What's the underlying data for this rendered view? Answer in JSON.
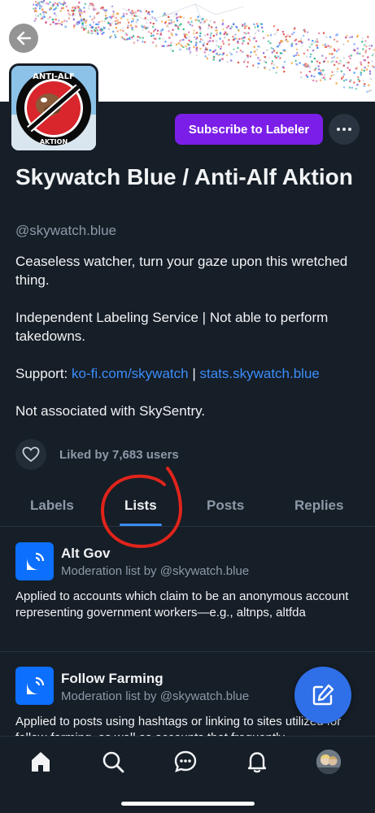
{
  "header": {
    "subscribe_label": "Subscribe to Labeler",
    "more_icon": "ellipsis-icon",
    "back_icon": "back-arrow-icon",
    "back_overlay_text": "Du"
  },
  "profile": {
    "display_name": "Skywatch Blue / Anti-Alf Aktion",
    "handle": "@skywatch.blue",
    "bio_line1": "Ceaseless watcher, turn your gaze upon this wretched thing.",
    "bio_line2": "Independent Labeling Service | Not able to perform takedowns.",
    "support_label": "Support: ",
    "support_link1": "ko-fi.com/skywatch",
    "support_sep": " | ",
    "support_link2": "stats.skywatch.blue",
    "bio_line4": "Not associated with SkySentry.",
    "avatar_text_top": "ANTI-ALF",
    "avatar_text_bottom": "AKTION",
    "likes_text": "Liked by 7,683 users"
  },
  "tabs": [
    {
      "label": "Labels",
      "active": false
    },
    {
      "label": "Lists",
      "active": true
    },
    {
      "label": "Posts",
      "active": false
    },
    {
      "label": "Replies",
      "active": false
    }
  ],
  "lists": [
    {
      "title": "Alt Gov",
      "subtitle": "Moderation list by @skywatch.blue",
      "description": "Applied to accounts which claim to be an anonymous account representing government workers—e.g., altnps, altfda"
    },
    {
      "title": "Follow Farming",
      "subtitle": "Moderation list by @skywatch.blue",
      "description": "Applied to posts using hashtags or linking to sites utilized for follow-farming, as well as accounts that frequently"
    }
  ],
  "nav": [
    "home-icon",
    "search-icon",
    "chat-icon",
    "bell-icon",
    "profile-avatar"
  ],
  "colors": {
    "background": "#161e27",
    "accent": "#3b8dfa",
    "subscribe": "#7b1fe8",
    "annotation": "#e0241b",
    "list_icon": "#0d6ffd"
  }
}
